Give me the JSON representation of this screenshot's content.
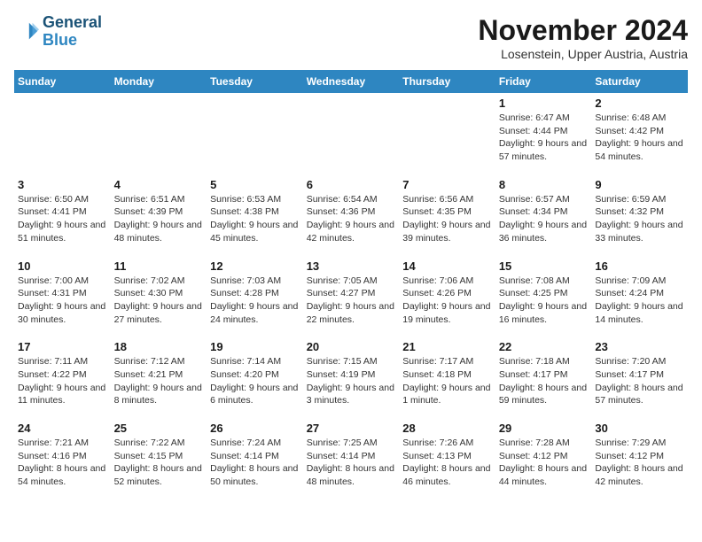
{
  "logo": {
    "line1": "General",
    "line2": "Blue"
  },
  "header": {
    "month": "November 2024",
    "location": "Losenstein, Upper Austria, Austria"
  },
  "days_of_week": [
    "Sunday",
    "Monday",
    "Tuesday",
    "Wednesday",
    "Thursday",
    "Friday",
    "Saturday"
  ],
  "weeks": [
    [
      {
        "day": "",
        "info": ""
      },
      {
        "day": "",
        "info": ""
      },
      {
        "day": "",
        "info": ""
      },
      {
        "day": "",
        "info": ""
      },
      {
        "day": "",
        "info": ""
      },
      {
        "day": "1",
        "info": "Sunrise: 6:47 AM\nSunset: 4:44 PM\nDaylight: 9 hours and 57 minutes."
      },
      {
        "day": "2",
        "info": "Sunrise: 6:48 AM\nSunset: 4:42 PM\nDaylight: 9 hours and 54 minutes."
      }
    ],
    [
      {
        "day": "3",
        "info": "Sunrise: 6:50 AM\nSunset: 4:41 PM\nDaylight: 9 hours and 51 minutes."
      },
      {
        "day": "4",
        "info": "Sunrise: 6:51 AM\nSunset: 4:39 PM\nDaylight: 9 hours and 48 minutes."
      },
      {
        "day": "5",
        "info": "Sunrise: 6:53 AM\nSunset: 4:38 PM\nDaylight: 9 hours and 45 minutes."
      },
      {
        "day": "6",
        "info": "Sunrise: 6:54 AM\nSunset: 4:36 PM\nDaylight: 9 hours and 42 minutes."
      },
      {
        "day": "7",
        "info": "Sunrise: 6:56 AM\nSunset: 4:35 PM\nDaylight: 9 hours and 39 minutes."
      },
      {
        "day": "8",
        "info": "Sunrise: 6:57 AM\nSunset: 4:34 PM\nDaylight: 9 hours and 36 minutes."
      },
      {
        "day": "9",
        "info": "Sunrise: 6:59 AM\nSunset: 4:32 PM\nDaylight: 9 hours and 33 minutes."
      }
    ],
    [
      {
        "day": "10",
        "info": "Sunrise: 7:00 AM\nSunset: 4:31 PM\nDaylight: 9 hours and 30 minutes."
      },
      {
        "day": "11",
        "info": "Sunrise: 7:02 AM\nSunset: 4:30 PM\nDaylight: 9 hours and 27 minutes."
      },
      {
        "day": "12",
        "info": "Sunrise: 7:03 AM\nSunset: 4:28 PM\nDaylight: 9 hours and 24 minutes."
      },
      {
        "day": "13",
        "info": "Sunrise: 7:05 AM\nSunset: 4:27 PM\nDaylight: 9 hours and 22 minutes."
      },
      {
        "day": "14",
        "info": "Sunrise: 7:06 AM\nSunset: 4:26 PM\nDaylight: 9 hours and 19 minutes."
      },
      {
        "day": "15",
        "info": "Sunrise: 7:08 AM\nSunset: 4:25 PM\nDaylight: 9 hours and 16 minutes."
      },
      {
        "day": "16",
        "info": "Sunrise: 7:09 AM\nSunset: 4:24 PM\nDaylight: 9 hours and 14 minutes."
      }
    ],
    [
      {
        "day": "17",
        "info": "Sunrise: 7:11 AM\nSunset: 4:22 PM\nDaylight: 9 hours and 11 minutes."
      },
      {
        "day": "18",
        "info": "Sunrise: 7:12 AM\nSunset: 4:21 PM\nDaylight: 9 hours and 8 minutes."
      },
      {
        "day": "19",
        "info": "Sunrise: 7:14 AM\nSunset: 4:20 PM\nDaylight: 9 hours and 6 minutes."
      },
      {
        "day": "20",
        "info": "Sunrise: 7:15 AM\nSunset: 4:19 PM\nDaylight: 9 hours and 3 minutes."
      },
      {
        "day": "21",
        "info": "Sunrise: 7:17 AM\nSunset: 4:18 PM\nDaylight: 9 hours and 1 minute."
      },
      {
        "day": "22",
        "info": "Sunrise: 7:18 AM\nSunset: 4:17 PM\nDaylight: 8 hours and 59 minutes."
      },
      {
        "day": "23",
        "info": "Sunrise: 7:20 AM\nSunset: 4:17 PM\nDaylight: 8 hours and 57 minutes."
      }
    ],
    [
      {
        "day": "24",
        "info": "Sunrise: 7:21 AM\nSunset: 4:16 PM\nDaylight: 8 hours and 54 minutes."
      },
      {
        "day": "25",
        "info": "Sunrise: 7:22 AM\nSunset: 4:15 PM\nDaylight: 8 hours and 52 minutes."
      },
      {
        "day": "26",
        "info": "Sunrise: 7:24 AM\nSunset: 4:14 PM\nDaylight: 8 hours and 50 minutes."
      },
      {
        "day": "27",
        "info": "Sunrise: 7:25 AM\nSunset: 4:14 PM\nDaylight: 8 hours and 48 minutes."
      },
      {
        "day": "28",
        "info": "Sunrise: 7:26 AM\nSunset: 4:13 PM\nDaylight: 8 hours and 46 minutes."
      },
      {
        "day": "29",
        "info": "Sunrise: 7:28 AM\nSunset: 4:12 PM\nDaylight: 8 hours and 44 minutes."
      },
      {
        "day": "30",
        "info": "Sunrise: 7:29 AM\nSunset: 4:12 PM\nDaylight: 8 hours and 42 minutes."
      }
    ]
  ]
}
